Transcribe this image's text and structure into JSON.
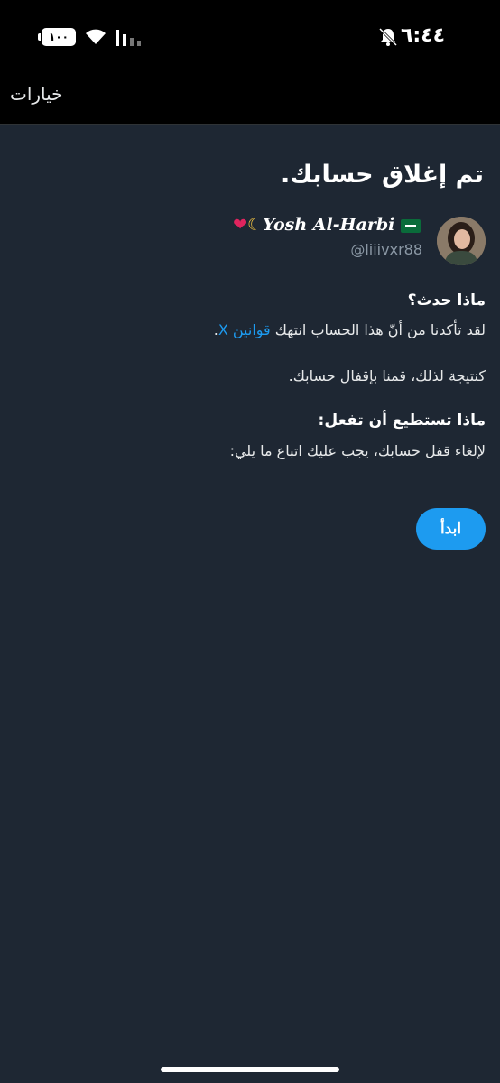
{
  "status_bar": {
    "battery": "١٠٠",
    "time": "٦:٤٤"
  },
  "top_bar": {
    "options_label": "خيارات"
  },
  "page": {
    "title": "تم إغلاق حسابك."
  },
  "profile": {
    "display_name": "Yosh Al-Harbi",
    "handle": "@liiivxr88"
  },
  "what_happened": {
    "heading": "ماذا حدث؟",
    "line1_prefix": "لقد تأكدنا من أنّ هذا الحساب انتهك ",
    "rules_link": "قوانين X",
    "line1_suffix": ".",
    "line2": "كنتيجة لذلك، قمنا بإقفال حسابك."
  },
  "what_to_do": {
    "heading": "ماذا تستطيع أن تفعل:",
    "line1": "لإلغاء قفل حسابك، يجب عليك اتباع ما يلي:"
  },
  "actions": {
    "start_label": "ابدأ"
  },
  "colors": {
    "background": "#1e2733",
    "accent": "#1d9bf0"
  }
}
